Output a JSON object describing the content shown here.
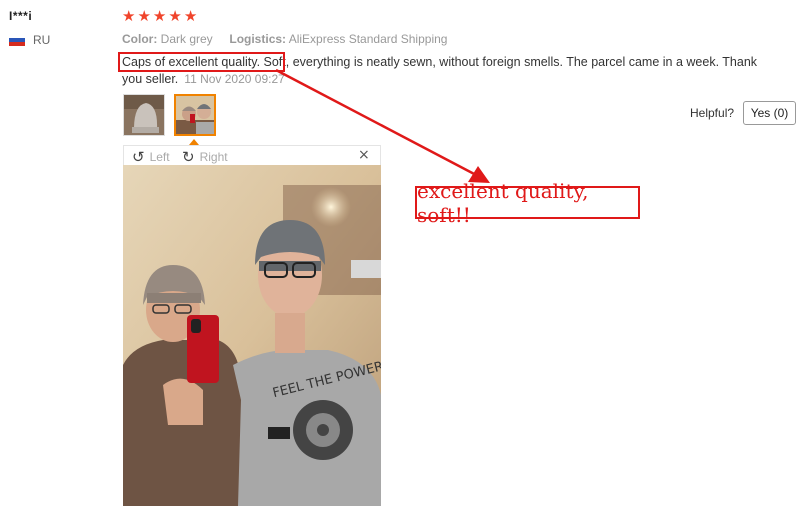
{
  "review": {
    "username": "I***i",
    "country_code": "RU",
    "rating_stars": 5,
    "star_char": "★",
    "color_label": "Color:",
    "color_value": "Dark grey",
    "logistics_label": "Logistics:",
    "logistics_value": "AliExpress Standard Shipping",
    "text": "Caps of excellent quality. Soft, everything is neatly sewn, without foreign smells. The parcel came in a week. Thank you seller.",
    "date": "11 Nov 2020 09:27"
  },
  "actions": {
    "helpful_label": "Helpful?",
    "yes_button": "Yes (0)"
  },
  "viewer": {
    "rotate_left_label": "Left",
    "rotate_right_label": "Right",
    "close_icon": "×"
  },
  "annotation": {
    "callout_text": "excellent quality, soft!!"
  },
  "colors": {
    "star": "#f0442b",
    "highlight": "#e01919",
    "active_thumb": "#f08200"
  }
}
